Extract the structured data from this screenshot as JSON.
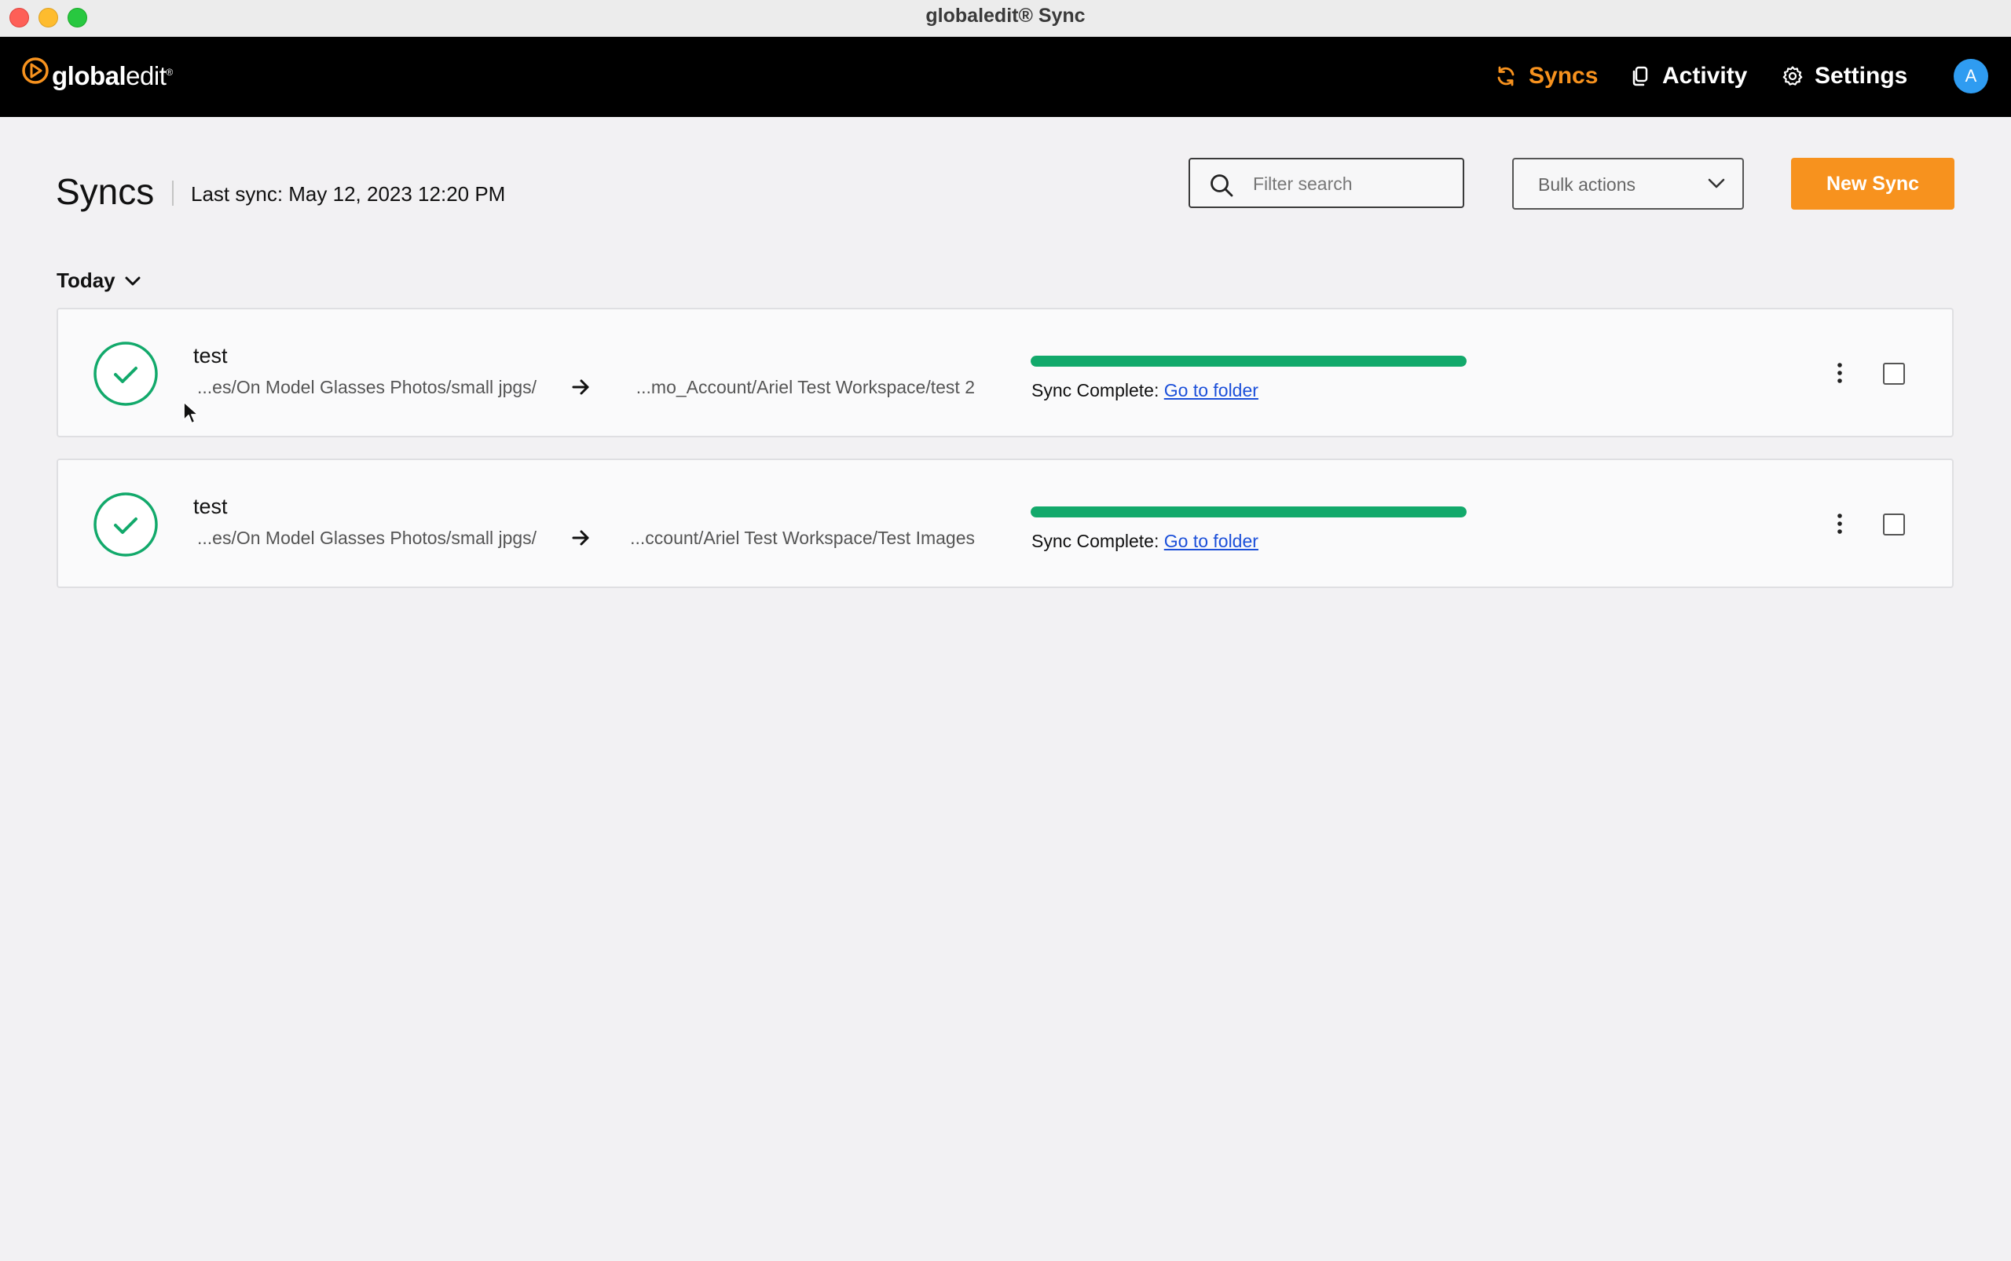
{
  "window": {
    "title": "globaledit® Sync"
  },
  "nav": {
    "logo_bold": "global",
    "logo_regular": "edit",
    "logo_mark": "®",
    "items": [
      {
        "label": "Syncs",
        "icon": "sync-icon",
        "active": true
      },
      {
        "label": "Activity",
        "icon": "activity-icon",
        "active": false
      },
      {
        "label": "Settings",
        "icon": "gear-icon",
        "active": false
      }
    ],
    "avatar_initial": "A"
  },
  "header": {
    "title": "Syncs",
    "last_sync": "Last sync: May 12, 2023 12:20 PM",
    "search_placeholder": "Filter search",
    "bulk_actions_label": "Bulk actions",
    "new_sync_label": "New Sync"
  },
  "group": {
    "label": "Today"
  },
  "syncs": [
    {
      "name": "test",
      "source": "...es/On Model Glasses Photos/small jpgs/",
      "destination": "...mo_Account/Ariel Test Workspace/test 2",
      "progress": 1.0,
      "status_label": "Sync Complete:",
      "link_label": "Go to folder"
    },
    {
      "name": "test",
      "source": "...es/On Model Glasses Photos/small jpgs/",
      "destination": "...ccount/Ariel Test Workspace/Test Images",
      "progress": 1.0,
      "status_label": "Sync Complete:",
      "link_label": "Go to folder"
    }
  ],
  "colors": {
    "accent": "#f7921e",
    "success": "#12a96b",
    "link": "#1b4fd9",
    "avatar": "#2f9cf1"
  }
}
